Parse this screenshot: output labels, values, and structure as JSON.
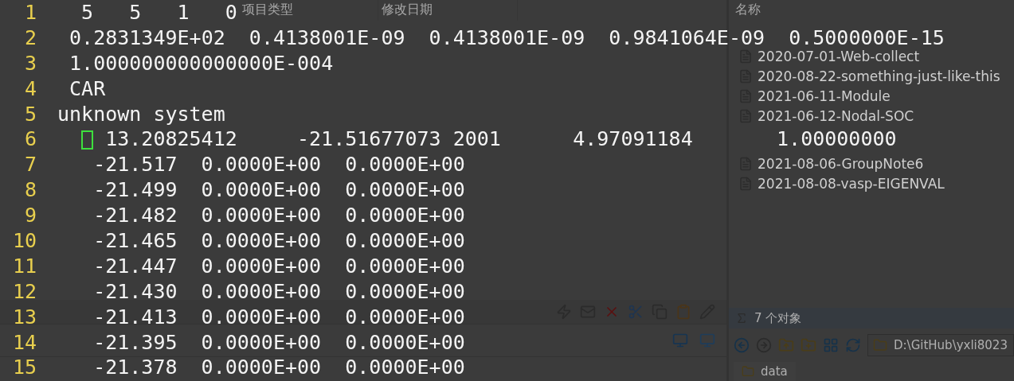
{
  "explorer": {
    "left_pane": {
      "columns": [
        "项目类型",
        "修改日期"
      ]
    },
    "right_pane": {
      "header": "名称",
      "items": [
        "2020-07-01-Web-collect",
        "2020-08-22-something-just-like-this",
        "2021-06-11-Module",
        "2021-06-12-Nodal-SOC",
        "2021-08-06-GroupNote6",
        "2021-08-08-vasp-EIGENVAL"
      ],
      "status": "7 个对象",
      "path": "D:\\GitHub\\yxli8023",
      "tab": "data"
    }
  },
  "editor": {
    "lines": [
      {
        "number": "1",
        "text": "  5   5   1   0",
        "cursor": false
      },
      {
        "number": "2",
        "text": " 0.2831349E+02  0.4138001E-09  0.4138001E-09  0.9841064E-09  0.5000000E-15",
        "cursor": false
      },
      {
        "number": "3",
        "text": " 1.000000000000000E-004",
        "cursor": false
      },
      {
        "number": "4",
        "text": " CAR",
        "cursor": false
      },
      {
        "number": "5",
        "text": "unknown system",
        "cursor": false
      },
      {
        "number": "6",
        "text": "    13.20825412     -21.51677073 2001      4.97091184       1.00000000",
        "cursor": true
      },
      {
        "number": "7",
        "text": "   -21.517  0.0000E+00  0.0000E+00",
        "cursor": false
      },
      {
        "number": "8",
        "text": "   -21.499  0.0000E+00  0.0000E+00",
        "cursor": false
      },
      {
        "number": "9",
        "text": "   -21.482  0.0000E+00  0.0000E+00",
        "cursor": false
      },
      {
        "number": "10",
        "text": "   -21.465  0.0000E+00  0.0000E+00",
        "cursor": false
      },
      {
        "number": "11",
        "text": "   -21.447  0.0000E+00  0.0000E+00",
        "cursor": false
      },
      {
        "number": "12",
        "text": "   -21.430  0.0000E+00  0.0000E+00",
        "cursor": false
      },
      {
        "number": "13",
        "text": "   -21.413  0.0000E+00  0.0000E+00",
        "cursor": false
      },
      {
        "number": "14",
        "text": "   -21.395  0.0000E+00  0.0000E+00",
        "cursor": false
      },
      {
        "number": "15",
        "text": "   -21.378  0.0000E+00  0.0000E+00",
        "cursor": false
      }
    ]
  }
}
